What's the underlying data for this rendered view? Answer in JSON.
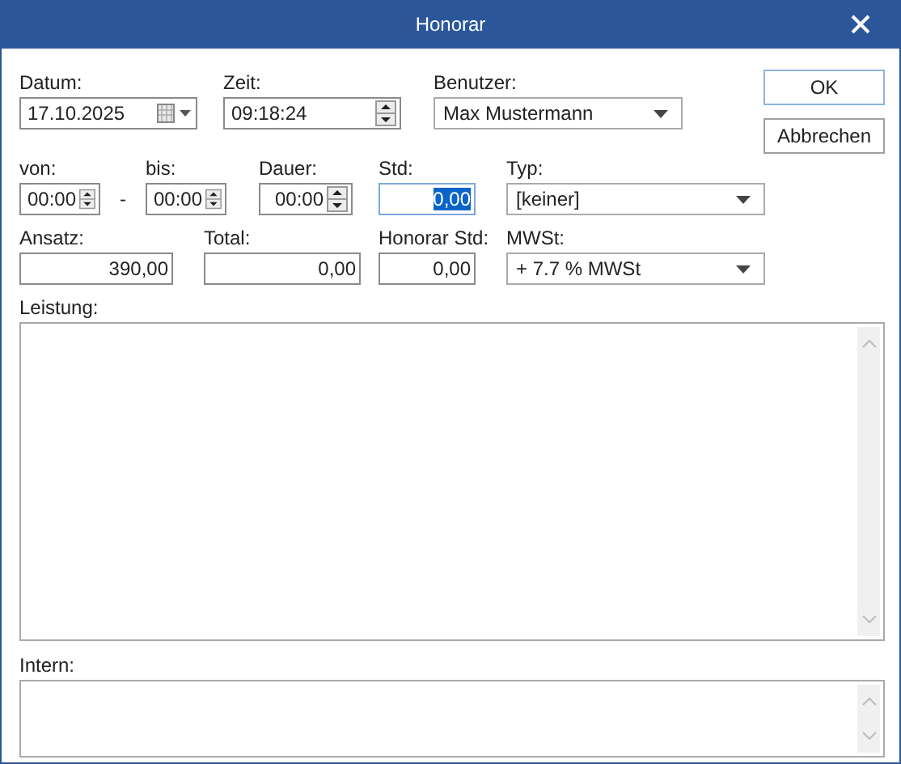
{
  "window": {
    "title": "Honorar"
  },
  "rows": [
    [
      {
        "kind": "date",
        "label": "Datum:",
        "value": "17.10.2025"
      },
      {
        "kind": "time",
        "label": "Zeit:",
        "value": "09:18:24"
      },
      {
        "kind": "dropdown",
        "label": "Benutzer:",
        "value": "Max Mustermann"
      }
    ],
    [
      {
        "kind": "spin",
        "label": "von:",
        "value": "00:00"
      },
      {
        "kind": "separator",
        "value": "-"
      },
      {
        "kind": "spin",
        "label": "bis:",
        "value": "00:00"
      },
      {
        "kind": "spin",
        "label": "Dauer:",
        "value": "00:00"
      },
      {
        "kind": "text",
        "label": "Std:",
        "value": "0,00",
        "focused": true
      },
      {
        "kind": "dropdown",
        "label": "Typ:",
        "value": "[keiner]"
      }
    ],
    [
      {
        "kind": "text",
        "label": "Ansatz:",
        "value": "390,00",
        "focused": false
      },
      {
        "kind": "text",
        "label": "Total:",
        "value": "0,00",
        "focused": false
      },
      {
        "kind": "text",
        "label": "Honorar Std:",
        "value": "0,00",
        "focused": false
      },
      {
        "kind": "dropdown",
        "label": "MWSt:",
        "value": "+ 7.7 % MWSt"
      }
    ]
  ],
  "buttons": [
    {
      "label": "OK",
      "default": true
    },
    {
      "label": "Abbrechen",
      "default": false
    }
  ],
  "memos": [
    {
      "label": "Leistung:"
    },
    {
      "label": "Intern:"
    }
  ]
}
